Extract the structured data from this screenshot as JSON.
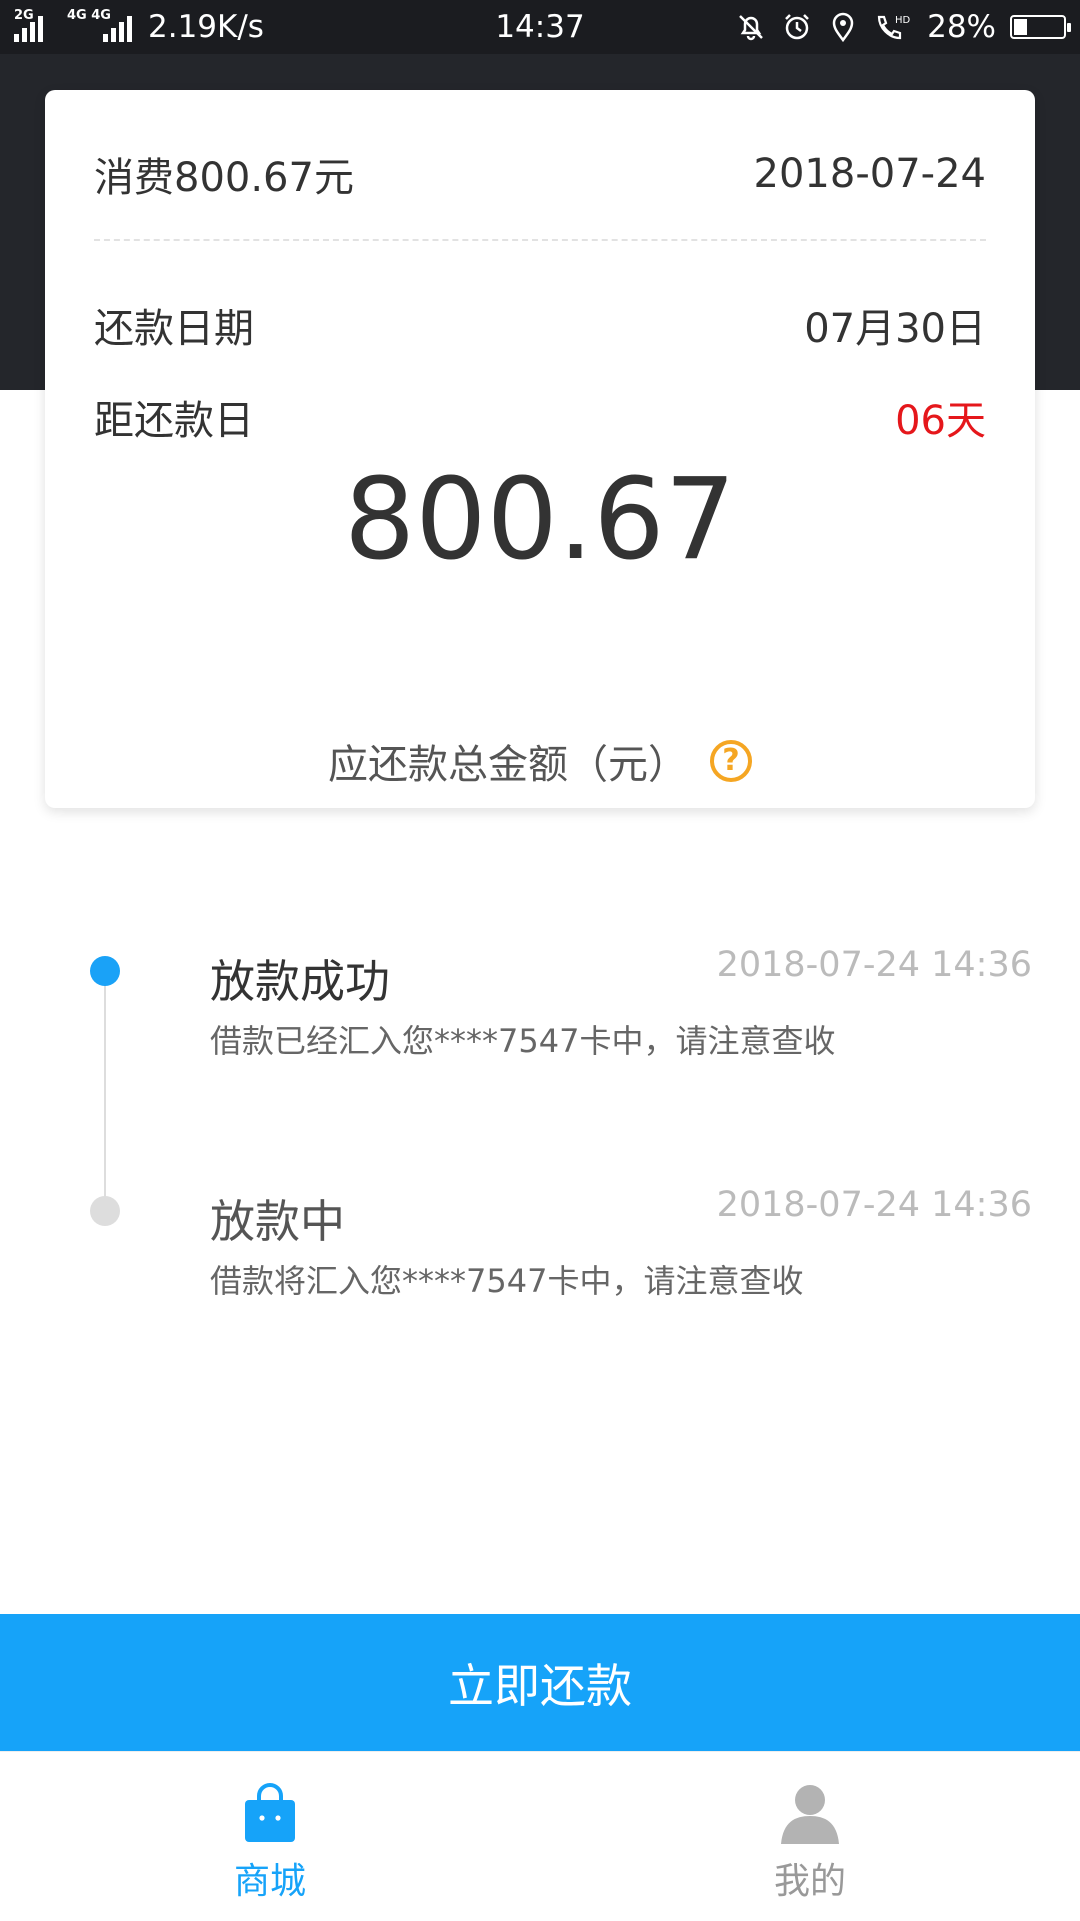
{
  "status_bar": {
    "sim1_tag": "2G",
    "sim2_tag": "4G 4G",
    "speed": "2.19K/s",
    "time": "14:37",
    "battery": "28%",
    "battery_level": 0.28,
    "icons": [
      "mute-bell-icon",
      "alarm-icon",
      "location-icon",
      "hd-call-icon"
    ]
  },
  "card": {
    "consume_label": "消费800.67元",
    "consume_date": "2018-07-24",
    "due_label": "还款日期",
    "due_value": "07月30日",
    "days_label": "距还款日",
    "days_value": "06天",
    "amount": "800.67",
    "amount_label": "应还款总金额（元）",
    "help_icon": "?"
  },
  "timeline": [
    {
      "title": "放款成功",
      "time": "2018-07-24 14:36",
      "desc": "借款已经汇入您****7547卡中，请注意查收"
    },
    {
      "title": "放款中",
      "time": "2018-07-24 14:36",
      "desc": "借款将汇入您****7547卡中，请注意查收"
    }
  ],
  "repay_button": "立即还款",
  "nav": {
    "shop": "商城",
    "mine": "我的"
  },
  "colors": {
    "accent": "#16a3f9",
    "red": "#e5171b",
    "help": "#f5a623"
  }
}
